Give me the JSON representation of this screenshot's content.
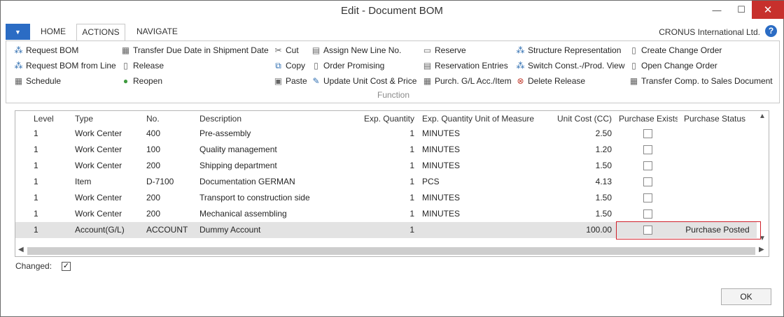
{
  "window": {
    "title": "Edit - Document BOM",
    "min": "—",
    "max": "☐",
    "close": "✕"
  },
  "ribbon_tabs": {
    "menu": "▼",
    "home": "HOME",
    "actions": "ACTIONS",
    "navigate": "NAVIGATE"
  },
  "company": "CRONUS International Ltd.",
  "help": "?",
  "ribbon": {
    "group_label": "Function",
    "col1": [
      "Request BOM",
      "Request BOM from Line",
      "Schedule"
    ],
    "col2": [
      "Transfer Due Date in Shipment Date",
      "Release",
      "Reopen"
    ],
    "col3": [
      "Cut",
      "Copy",
      "Paste"
    ],
    "col4": [
      "Assign New Line No.",
      "Order Promising",
      "Update Unit Cost & Price"
    ],
    "col5": [
      "Reserve",
      "Reservation Entries",
      "Purch. G/L Acc./Item"
    ],
    "col6": [
      "Structure Representation",
      "Switch Const.-/Prod. View",
      "Delete Release"
    ],
    "col7": [
      "Create Change Order",
      "Open Change Order",
      "Transfer Comp. to Sales Document"
    ]
  },
  "grid": {
    "headers": {
      "level": "Level",
      "type": "Type",
      "no": "No.",
      "description": "Description",
      "exp_qty": "Exp. Quantity",
      "exp_uom": "Exp. Quantity Unit of Measure",
      "unit_cost": "Unit Cost (CC)",
      "purchase_exists": "Purchase Exists",
      "purchase_status": "Purchase Status"
    },
    "rows": [
      {
        "level": "1",
        "type": "Work Center",
        "no": "400",
        "description": "Pre-assembly",
        "exp_qty": "1",
        "exp_uom": "MINUTES",
        "unit_cost": "2.50",
        "purchase_status": ""
      },
      {
        "level": "1",
        "type": "Work Center",
        "no": "100",
        "description": "Quality management",
        "exp_qty": "1",
        "exp_uom": "MINUTES",
        "unit_cost": "1.20",
        "purchase_status": ""
      },
      {
        "level": "1",
        "type": "Work Center",
        "no": "200",
        "description": "Shipping department",
        "exp_qty": "1",
        "exp_uom": "MINUTES",
        "unit_cost": "1.50",
        "purchase_status": ""
      },
      {
        "level": "1",
        "type": "Item",
        "no": "D-7100",
        "description": "Documentation GERMAN",
        "exp_qty": "1",
        "exp_uom": "PCS",
        "unit_cost": "4.13",
        "purchase_status": ""
      },
      {
        "level": "1",
        "type": "Work Center",
        "no": "200",
        "description": "Transport to construction side",
        "exp_qty": "1",
        "exp_uom": "MINUTES",
        "unit_cost": "1.50",
        "purchase_status": ""
      },
      {
        "level": "1",
        "type": "Work Center",
        "no": "200",
        "description": "Mechanical assembling",
        "exp_qty": "1",
        "exp_uom": "MINUTES",
        "unit_cost": "1.50",
        "purchase_status": ""
      },
      {
        "level": "1",
        "type": "Account(G/L)",
        "no": "ACCOUNT",
        "description": "Dummy Account",
        "exp_qty": "1",
        "exp_uom": "",
        "unit_cost": "100.00",
        "purchase_status": "Purchase Posted"
      }
    ]
  },
  "changed": {
    "label": "Changed:",
    "check": "✓"
  },
  "ok_button": "OK"
}
